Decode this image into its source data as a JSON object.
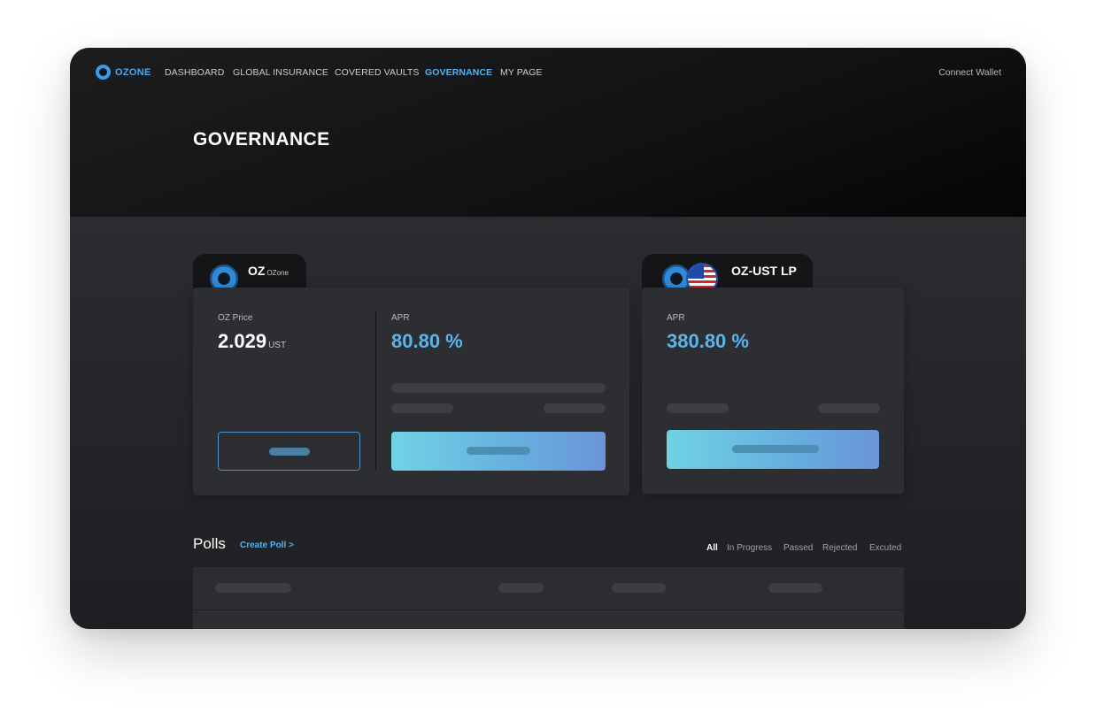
{
  "nav": {
    "logo_text": "OZONE",
    "items": [
      {
        "label": "DASHBOARD",
        "active": false
      },
      {
        "label": "GLOBAL INSURANCE",
        "active": false
      },
      {
        "label": "COVERED VAULTS",
        "active": false
      },
      {
        "label": "GOVERNANCE",
        "active": true
      },
      {
        "label": "MY PAGE",
        "active": false
      }
    ],
    "connect_wallet": "Connect Wallet"
  },
  "page": {
    "title": "GOVERNANCE"
  },
  "oz_card": {
    "ticker": "OZ",
    "ticker_sub": "OZone",
    "price_label": "OZ Price",
    "price_value": "2.029",
    "price_unit": "UST",
    "apr_label": "APR",
    "apr_value": "80.80 %"
  },
  "lp_card": {
    "ticker": "OZ-UST LP",
    "apr_label": "APR",
    "apr_value": "380.80 %"
  },
  "polls": {
    "title": "Polls",
    "create_link": "Create Poll >",
    "filters": [
      {
        "label": "All",
        "active": true
      },
      {
        "label": "In Progress",
        "active": false
      },
      {
        "label": "Passed",
        "active": false
      },
      {
        "label": "Rejected",
        "active": false
      },
      {
        "label": "Excuted",
        "active": false
      }
    ]
  },
  "colors": {
    "accent": "#4fb3f0",
    "apr_blue": "#5cb4ee",
    "button_gradient_start": "#70d2e4",
    "button_gradient_end": "#6b94d8"
  }
}
